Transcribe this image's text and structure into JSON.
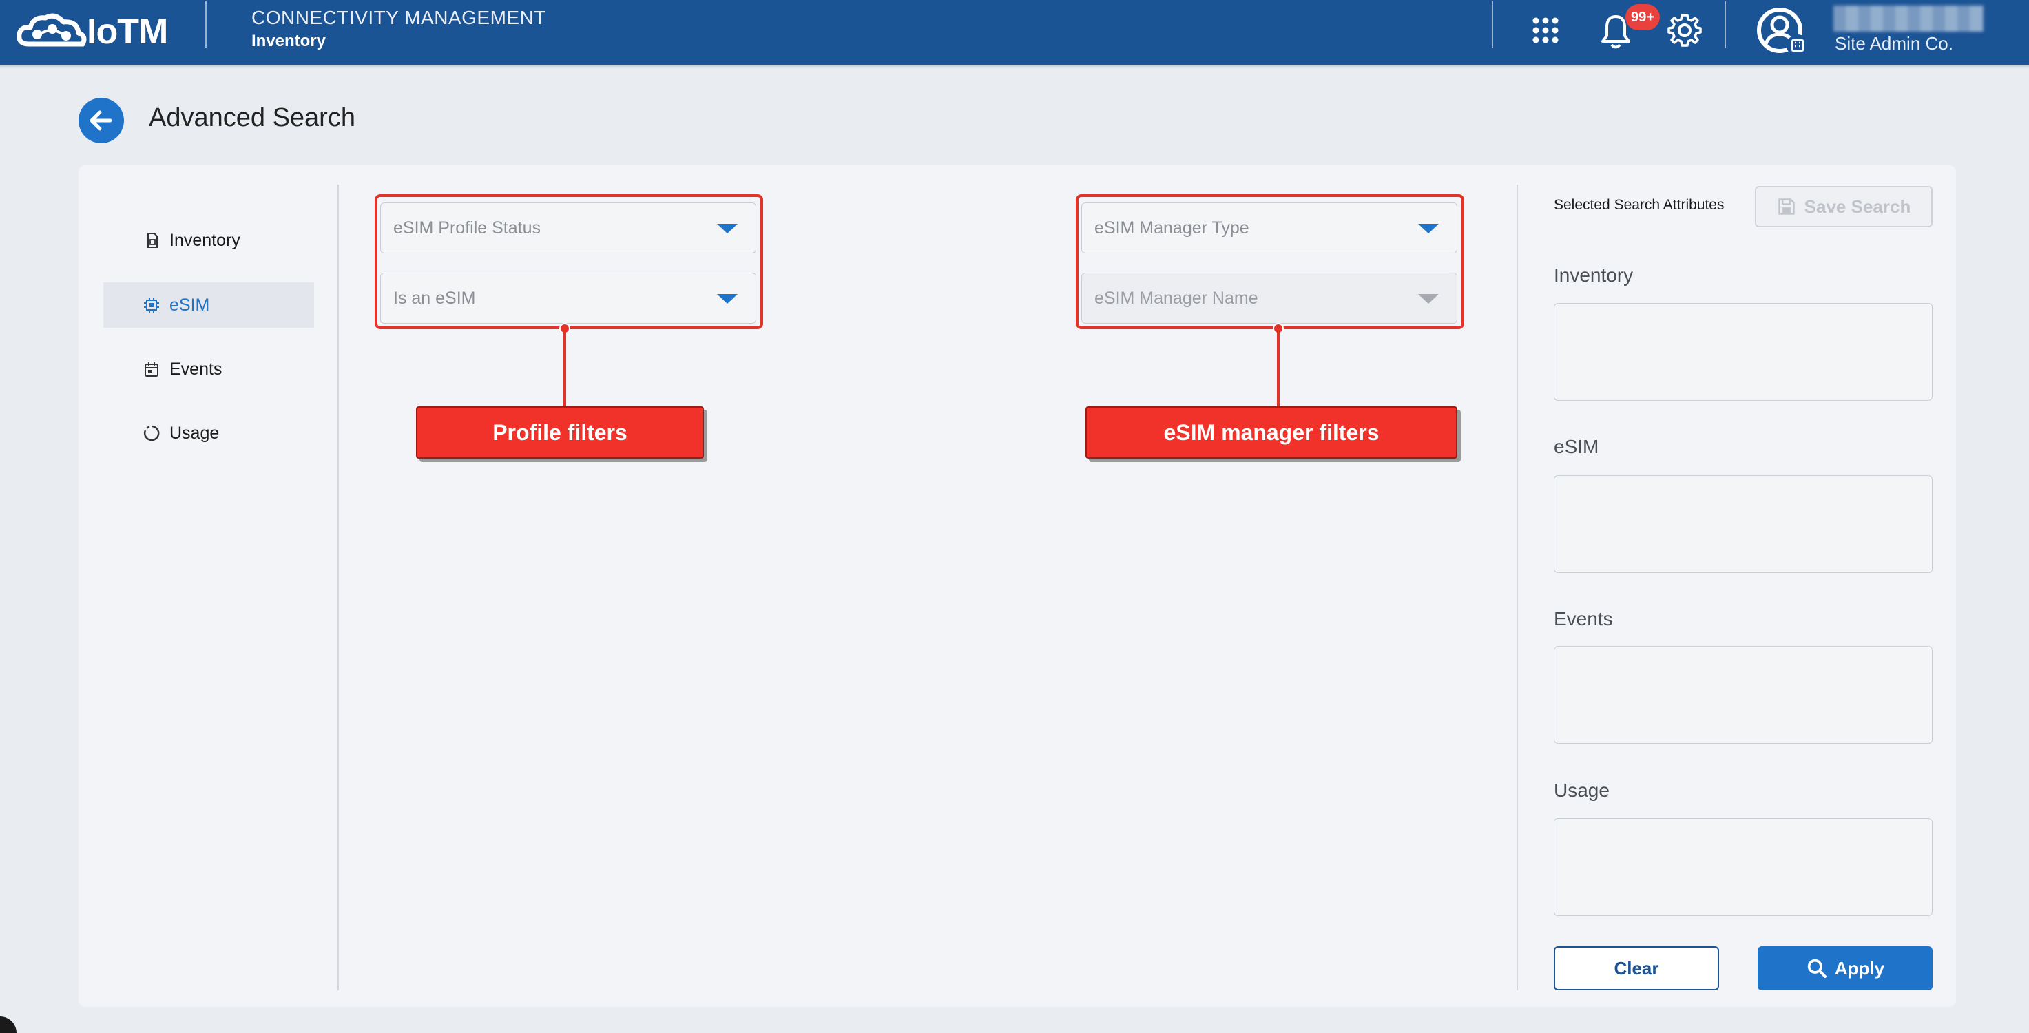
{
  "header": {
    "logo_text": "IoTM",
    "app_title": "CONNECTIVITY MANAGEMENT",
    "app_subtitle": "Inventory",
    "icons": [
      "apps-grid-icon",
      "bell-icon",
      "gear-icon",
      "user-avatar-icon"
    ],
    "notification_count": "99+",
    "user_org": "Site Admin Co."
  },
  "page": {
    "title": "Advanced Search"
  },
  "nav": {
    "items": [
      {
        "label": "Inventory",
        "icon": "sim-card-icon",
        "active": false
      },
      {
        "label": "eSIM",
        "icon": "chip-icon",
        "active": true
      },
      {
        "label": "Events",
        "icon": "calendar-icon",
        "active": false
      },
      {
        "label": "Usage",
        "icon": "usage-ring-icon",
        "active": false
      }
    ]
  },
  "filters": {
    "profile": [
      {
        "placeholder": "eSIM Profile Status"
      },
      {
        "placeholder": "Is an eSIM"
      }
    ],
    "manager": [
      {
        "placeholder": "eSIM Manager Type"
      },
      {
        "placeholder": "eSIM Manager Name",
        "disabled": true
      }
    ]
  },
  "annotations": {
    "profile_label": "Profile filters",
    "manager_label": "eSIM manager filters"
  },
  "attributes": {
    "title": "Selected Search Attributes",
    "save_label": "Save Search",
    "sections": [
      "Inventory",
      "eSIM",
      "Events",
      "Usage"
    ],
    "clear_label": "Clear",
    "apply_label": "Apply"
  },
  "colors": {
    "header_bg": "#1b5495",
    "accent": "#1f73c9",
    "badge": "#e8413e",
    "annotation": "#e5332a"
  }
}
